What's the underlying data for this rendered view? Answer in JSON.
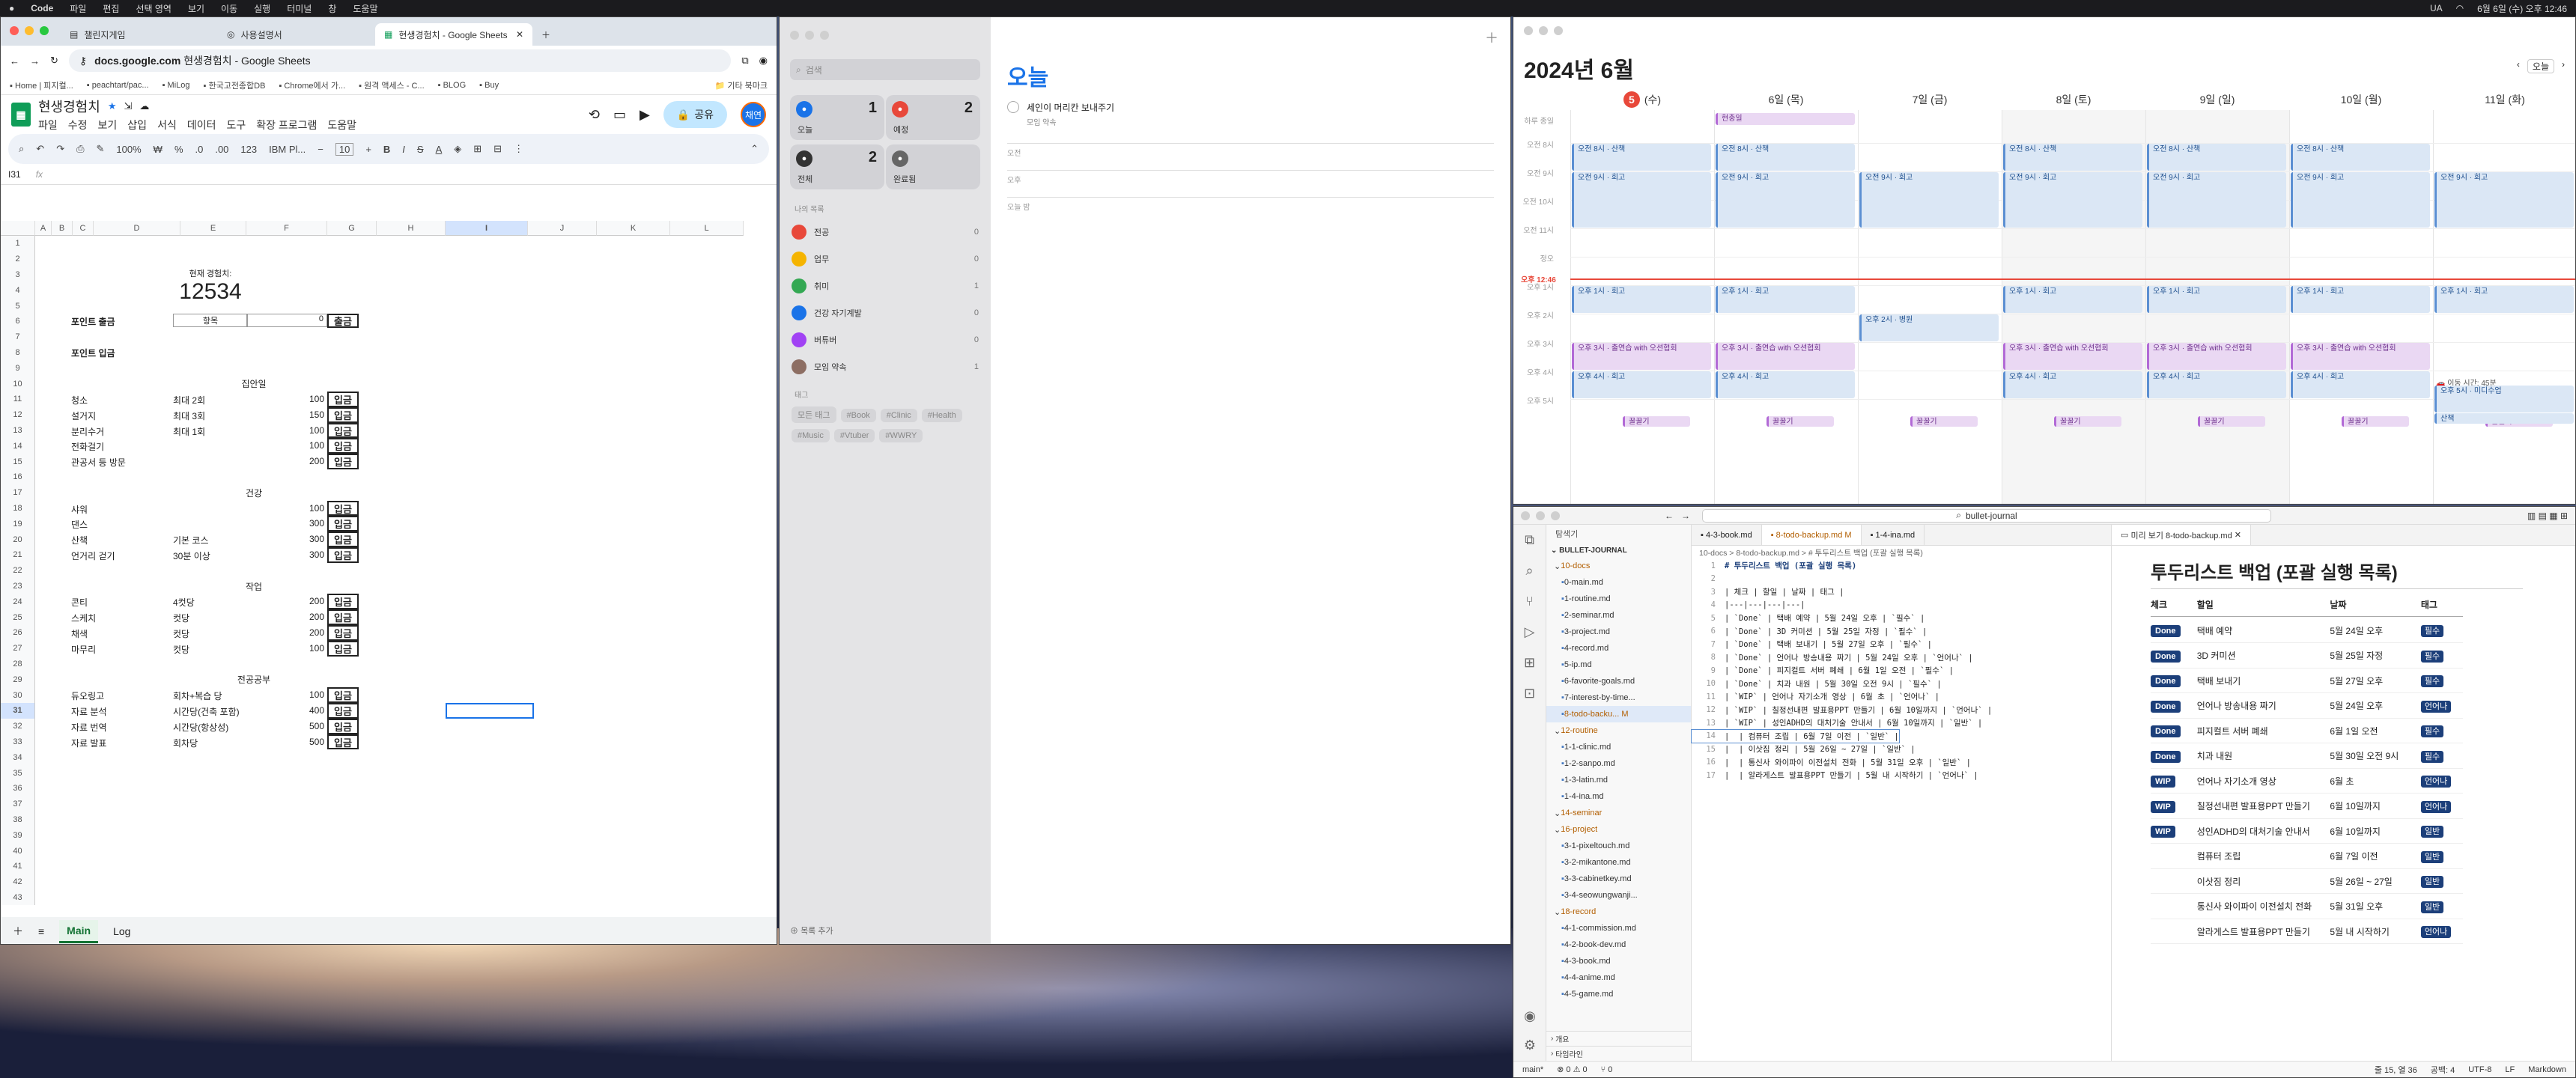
{
  "menubar": {
    "app": "Code",
    "items": [
      "파일",
      "편집",
      "선택 영역",
      "보기",
      "이동",
      "실행",
      "터미널",
      "창",
      "도움말"
    ],
    "clock": "6월 6일 (수) 오후 12:46",
    "lang": "UA"
  },
  "chrome": {
    "tabs": [
      {
        "label": "챌린지게임"
      },
      {
        "label": "사용설명서"
      },
      {
        "label": "현생경험치 - Google Sheets"
      }
    ],
    "url": "docs.google.com",
    "url_rest": "현생경험치 - Google Sheets",
    "bookmarks": [
      "Home | 피지컬...",
      "peachtart/pac...",
      "MiLog",
      "한국고전종합DB",
      "Chrome에서 가...",
      "원격 액세스 - C...",
      "BLOG",
      "Buy"
    ],
    "bookmarks_other": "기타 북마크"
  },
  "sheets": {
    "title": "현생경험치",
    "menus": [
      "파일",
      "수정",
      "보기",
      "삽입",
      "서식",
      "데이터",
      "도구",
      "확장 프로그램",
      "도움말"
    ],
    "share": "공유",
    "avatar": "채연",
    "zoom": "100%",
    "font": "IBM Pl...",
    "size": "10",
    "cellref": "I31",
    "fx": "fx",
    "cols": [
      "A",
      "B",
      "C",
      "D",
      "E",
      "F",
      "G",
      "H",
      "I",
      "J",
      "K",
      "L"
    ],
    "exp_label": "현재 경험치:",
    "exp_value": "12534",
    "withdraw_label": "포인트 출금",
    "withdraw_item": "항목",
    "withdraw_amt": "0",
    "withdraw_btn": "출금",
    "deposit_label": "포인트 입금",
    "sections": [
      {
        "name": "집안일",
        "row": 10,
        "items": [
          [
            "청소",
            "최대 2회",
            "100"
          ],
          [
            "설거지",
            "최대 3회",
            "150"
          ],
          [
            "분리수거",
            "최대 1회",
            "100"
          ],
          [
            "전화걸기",
            "",
            "100"
          ],
          [
            "관공서 등 방문",
            "",
            "200"
          ]
        ]
      },
      {
        "name": "건강",
        "row": 17,
        "items": [
          [
            "샤워",
            "",
            "100"
          ],
          [
            "댄스",
            "",
            "300"
          ],
          [
            "산책",
            "기본 코스",
            "300"
          ],
          [
            "언거리 걷기",
            "30분 이상",
            "300"
          ]
        ]
      },
      {
        "name": "작업",
        "row": 23,
        "items": [
          [
            "콘티",
            "4컷당",
            "200"
          ],
          [
            "스케치",
            "컷당",
            "200"
          ],
          [
            "채색",
            "컷당",
            "200"
          ],
          [
            "마무리",
            "컷당",
            "100"
          ]
        ]
      },
      {
        "name": "전공공부",
        "row": 29,
        "items": [
          [
            "듀오링고",
            "회차+복습 당",
            "100"
          ],
          [
            "자료 분석",
            "시간당(건축 포함)",
            "400"
          ],
          [
            "자료 번역",
            "시간당(항상성)",
            "500"
          ],
          [
            "자료 발표",
            "회차당",
            "500"
          ]
        ]
      }
    ],
    "deposit_btn": "입금",
    "sheet_tabs": [
      "Main",
      "Log"
    ]
  },
  "reminders": {
    "search": "검색",
    "smart": [
      {
        "label": "오늘",
        "count": "1",
        "color": "#1a73e8"
      },
      {
        "label": "예정",
        "count": "2",
        "color": "#e8483a"
      },
      {
        "label": "전체",
        "count": "2",
        "color": "#333"
      },
      {
        "label": "완료됨",
        "count": "",
        "color": "#666"
      }
    ],
    "section": "나의 목록",
    "lists": [
      {
        "label": "전공",
        "count": "0",
        "color": "#e8483a"
      },
      {
        "label": "업무",
        "count": "0",
        "color": "#f5b400"
      },
      {
        "label": "취미",
        "count": "1",
        "color": "#34a853"
      },
      {
        "label": "건강 자기계발",
        "count": "0",
        "color": "#1a73e8"
      },
      {
        "label": "버튜버",
        "count": "0",
        "color": "#a142f4"
      },
      {
        "label": "모임 약속",
        "count": "1",
        "color": "#8d6e63"
      }
    ],
    "tags_label": "태그",
    "tags": [
      "모든 태그",
      "#Book",
      "#Clinic",
      "#Health",
      "#Music",
      "#Vtuber",
      "#WWRY"
    ],
    "add_list": "목록 추가",
    "main_title": "오늘",
    "task": "세인이 머리칸 보내주기",
    "task_sub": "모임 약속",
    "groups": [
      "오전",
      "오후",
      "오늘 밤"
    ]
  },
  "calendar": {
    "title": "2024년 6월",
    "today_btn": "오늘",
    "days": [
      {
        "label": "5일 (수)",
        "today": true
      },
      {
        "label": "6일 (목)"
      },
      {
        "label": "7일 (금)"
      },
      {
        "label": "8일 (토)"
      },
      {
        "label": "9일 (일)"
      },
      {
        "label": "10일 (월)"
      },
      {
        "label": "11일 (화)"
      }
    ],
    "allday": "하루 종일",
    "allday_event": "현충일",
    "times": [
      "오전 8시",
      "오전 9시",
      "오전 10시",
      "오전 11시",
      "정오",
      "오후 1시",
      "오후 2시",
      "오후 3시",
      "오후 4시",
      "오후 5시"
    ],
    "now": "오후 12:46",
    "ev_walk": "오전 8시\n산책",
    "ev_work_am": "오전 9시\n회고",
    "ev_work_pm": "오후 1시\n회고",
    "ev_hosp": "오후 2시\n병원",
    "ev_practice": "오후 3시\n출연습 with 오션협회",
    "ev_pm4": "오후 4시\n회고",
    "ev_move": "이동 시간: 45분",
    "ev_pm5": "오후 5시\n미디수업",
    "ev_walk2": "산책",
    "ev_keep": "꿀꿀기"
  },
  "vscode": {
    "title": "bullet-journal",
    "explorer_title": "탐색기",
    "root": "BULLET-JOURNAL",
    "tree": [
      {
        "label": "10-docs",
        "folder": true,
        "indent": 1
      },
      {
        "label": "0-main.md",
        "indent": 2
      },
      {
        "label": "1-routine.md",
        "indent": 2
      },
      {
        "label": "2-seminar.md",
        "indent": 2
      },
      {
        "label": "3-project.md",
        "indent": 2
      },
      {
        "label": "4-record.md",
        "indent": 2
      },
      {
        "label": "5-ip.md",
        "indent": 2
      },
      {
        "label": "6-favorite-goals.md",
        "indent": 2
      },
      {
        "label": "7-interest-by-time...",
        "indent": 2
      },
      {
        "label": "8-todo-backu... M",
        "indent": 2,
        "active": true
      },
      {
        "label": "12-routine",
        "folder": true,
        "indent": 1
      },
      {
        "label": "1-1-clinic.md",
        "indent": 2
      },
      {
        "label": "1-2-sanpo.md",
        "indent": 2
      },
      {
        "label": "1-3-latin.md",
        "indent": 2
      },
      {
        "label": "1-4-ina.md",
        "indent": 2
      },
      {
        "label": "14-seminar",
        "folder": true,
        "indent": 1
      },
      {
        "label": "16-project",
        "folder": true,
        "indent": 1
      },
      {
        "label": "3-1-pixeltouch.md",
        "indent": 2
      },
      {
        "label": "3-2-mikantone.md",
        "indent": 2
      },
      {
        "label": "3-3-cabinetkey.md",
        "indent": 2
      },
      {
        "label": "3-4-seowungwanji...",
        "indent": 2
      },
      {
        "label": "18-record",
        "folder": true,
        "indent": 1
      },
      {
        "label": "4-1-commission.md",
        "indent": 2
      },
      {
        "label": "4-2-book-dev.md",
        "indent": 2
      },
      {
        "label": "4-3-book.md",
        "indent": 2
      },
      {
        "label": "4-4-anime.md",
        "indent": 2
      },
      {
        "label": "4-5-game.md",
        "indent": 2
      }
    ],
    "outline": "개요",
    "timeline": "타임라인",
    "tabs": [
      "4-3-book.md",
      "8-todo-backup.md M",
      "1-4-ina.md"
    ],
    "breadcrumb": "10-docs > 8-todo-backup.md > # 투두리스트 백업 (포괄 실행 목록)",
    "lines": [
      "# 투두리스트 백업 (포괄 실행 목록)",
      "",
      "| 체크 | 할일 | 날짜 | 태그 |",
      "|---|---|---|---|",
      "| `Done` | 택배 예약 | 5월 24일 오후 | `필수` |",
      "| `Done` | 3D 커미션 | 5월 25일 자정 | `필수` |",
      "| `Done` | 택배 보내기 | 5월 27일 오후 | `필수` |",
      "| `Done` | 언어나 방송내용 짜기 | 5월 24일 오후 | `언어나` |",
      "| `Done` | 피지컬트 서버 폐쇄 | 6월 1일 오전 | `필수` |",
      "| `Done` | 치과 내원 | 5월 30일 오전 9시 | `필수` |",
      "| `WIP` | 언어나 자기소개 영상 | 6월 초 | `언어나` |",
      "| `WIP` | 칠정선내편 발표용PPT 만들기 | 6월 10일까지 | `언어나` |",
      "| `WIP` | 성인ADHD의 대처기술 안내서 | 6월 10일까지 | `일반` |",
      "|  | 컴퓨터 조립 | 6월 7일 이전 | `일반` |",
      "|  | 이삿짐 정리 | 5월 26일 ~ 27일 | `일반` |",
      "|  | 통신사 와이파이 이전설치 전화 | 5월 31일 오후 | `일반` |",
      "|  | 알라게스트 발표용PPT 만들기 | 5월 내 시작하기 | `언어나` |"
    ],
    "preview_tab": "미리 보기 8-todo-backup.md",
    "preview_title": "투두리스트 백업 (포괄 실행 목록)",
    "preview_headers": [
      "체크",
      "할일",
      "날짜",
      "태그"
    ],
    "rows": [
      [
        "Done",
        "택배 예약",
        "5월 24일 오후",
        "필수"
      ],
      [
        "Done",
        "3D 커미션",
        "5월 25일 자정",
        "필수"
      ],
      [
        "Done",
        "택배 보내기",
        "5월 27일 오후",
        "필수"
      ],
      [
        "Done",
        "언어나 방송내용 짜기",
        "5월 24일 오후",
        "언어나"
      ],
      [
        "Done",
        "피지컬트 서버 폐쇄",
        "6월 1일 오전",
        "필수"
      ],
      [
        "Done",
        "치과 내원",
        "5월 30일 오전 9시",
        "필수"
      ],
      [
        "WIP",
        "언어나 자기소개 영상",
        "6월 초",
        "언어나"
      ],
      [
        "WIP",
        "칠정선내편 발표용PPT 만들기",
        "6월 10일까지",
        "언어나"
      ],
      [
        "WIP",
        "성인ADHD의 대처기술 안내서",
        "6월 10일까지",
        "일반"
      ],
      [
        "",
        "컴퓨터 조립",
        "6월 7일 이전",
        "일반"
      ],
      [
        "",
        "이삿짐 정리",
        "5월 26일 ~ 27일",
        "일반"
      ],
      [
        "",
        "통신사 와이파이 이전설치 전화",
        "5월 31일 오후",
        "일반"
      ],
      [
        "",
        "알라게스트 발표용PPT 만들기",
        "5월 내 시작하기",
        "언어나"
      ]
    ],
    "status": [
      "main*",
      "⊗ 0 ⚠ 0",
      "⑂ 0"
    ],
    "status_right": [
      "줄 15, 열 36",
      "공백: 4",
      "UTF-8",
      "LF",
      "Markdown"
    ]
  }
}
